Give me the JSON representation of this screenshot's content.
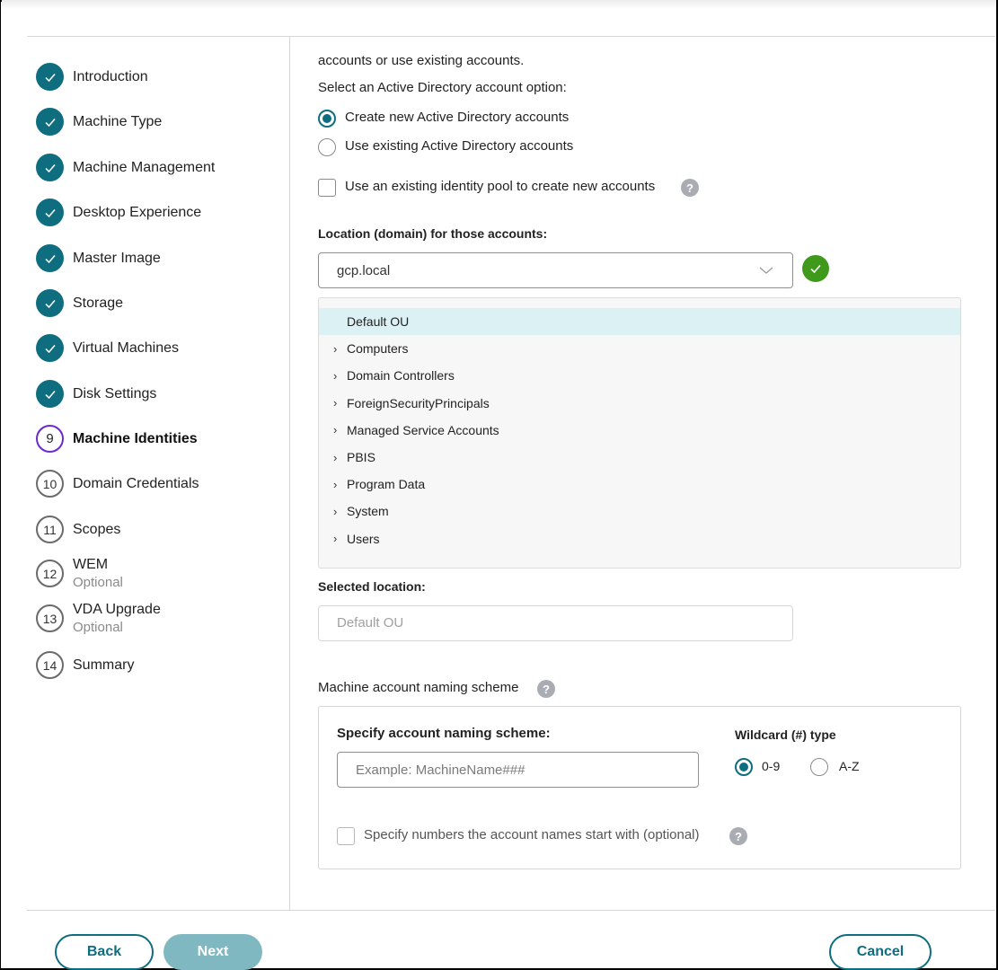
{
  "sidebar": {
    "steps": [
      {
        "num": "1",
        "label": "Introduction",
        "state": "done"
      },
      {
        "num": "2",
        "label": "Machine Type",
        "state": "done"
      },
      {
        "num": "3",
        "label": "Machine Management",
        "state": "done"
      },
      {
        "num": "4",
        "label": "Desktop Experience",
        "state": "done"
      },
      {
        "num": "5",
        "label": "Master Image",
        "state": "done"
      },
      {
        "num": "6",
        "label": "Storage",
        "state": "done"
      },
      {
        "num": "7",
        "label": "Virtual Machines",
        "state": "done"
      },
      {
        "num": "8",
        "label": "Disk Settings",
        "state": "done"
      },
      {
        "num": "9",
        "label": "Machine Identities",
        "state": "current"
      },
      {
        "num": "10",
        "label": "Domain Credentials",
        "state": "todo"
      },
      {
        "num": "11",
        "label": "Scopes",
        "state": "todo"
      },
      {
        "num": "12",
        "label": "WEM",
        "sub": "Optional",
        "state": "todo"
      },
      {
        "num": "13",
        "label": "VDA Upgrade",
        "sub": "Optional",
        "state": "todo"
      },
      {
        "num": "14",
        "label": "Summary",
        "state": "todo"
      }
    ]
  },
  "main": {
    "intro_text": "accounts or use existing accounts.",
    "ad_option_label": "Select an Active Directory account option:",
    "ad_options": [
      {
        "label": "Create new Active Directory accounts",
        "selected": true
      },
      {
        "label": "Use existing Active Directory accounts",
        "selected": false
      }
    ],
    "identity_pool_checkbox": {
      "label": "Use an existing identity pool to create new accounts",
      "checked": false
    },
    "location_label": "Location (domain) for those accounts:",
    "domain_select": {
      "value": "gcp.local",
      "valid": true
    },
    "ou_tree": [
      {
        "name": "Default OU",
        "expandable": false,
        "selected": true
      },
      {
        "name": "Computers",
        "expandable": true,
        "selected": false
      },
      {
        "name": "Domain Controllers",
        "expandable": true,
        "selected": false
      },
      {
        "name": "ForeignSecurityPrincipals",
        "expandable": true,
        "selected": false
      },
      {
        "name": "Managed Service Accounts",
        "expandable": true,
        "selected": false
      },
      {
        "name": "PBIS",
        "expandable": true,
        "selected": false
      },
      {
        "name": "Program Data",
        "expandable": true,
        "selected": false
      },
      {
        "name": "System",
        "expandable": true,
        "selected": false
      },
      {
        "name": "Users",
        "expandable": true,
        "selected": false
      }
    ],
    "selected_location_label": "Selected location:",
    "selected_location_value": "Default OU",
    "naming_scheme_label": "Machine account naming scheme",
    "naming_box": {
      "specify_label": "Specify account naming scheme:",
      "input_placeholder": "Example: MachineName###",
      "input_value": "",
      "wildcard_label": "Wildcard (#) type",
      "wildcard_options": [
        {
          "label": "0-9",
          "selected": true
        },
        {
          "label": "A-Z",
          "selected": false
        }
      ],
      "start_numbers_checkbox": {
        "label": "Specify numbers the account names start with (optional)",
        "checked": false
      }
    },
    "help_glyph": "?"
  },
  "footer": {
    "back_label": "Back",
    "next_label": "Next",
    "cancel_label": "Cancel"
  },
  "colors": {
    "accent": "#0f6d80",
    "current_step": "#6a2bcd",
    "success": "#3f9a1c",
    "tree_selected": "#dcf1f4",
    "next_disabled": "#80b8c2"
  }
}
